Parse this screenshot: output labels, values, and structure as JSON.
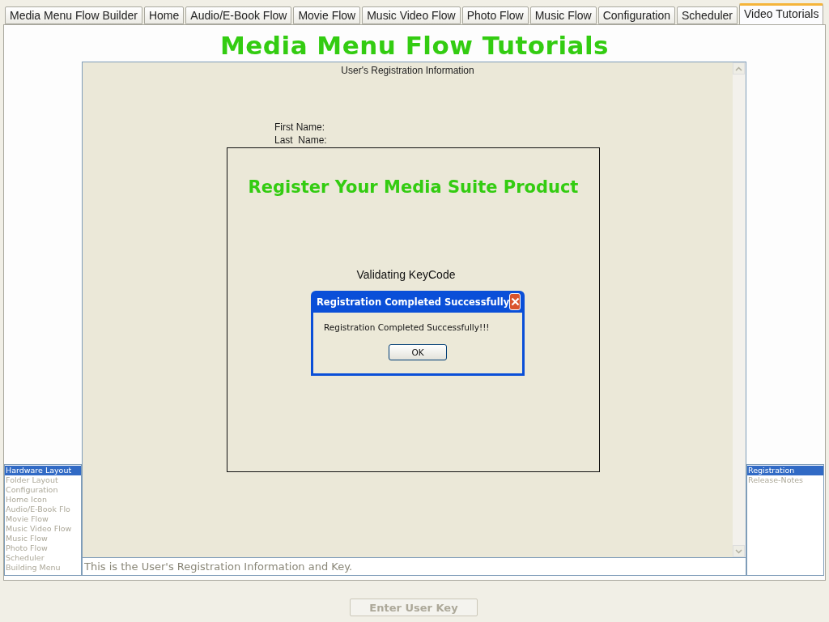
{
  "tabs": [
    {
      "label": "Media Menu Flow Builder",
      "selected": false
    },
    {
      "label": "Home",
      "selected": false
    },
    {
      "label": "Audio/E-Book Flow",
      "selected": false
    },
    {
      "label": "Movie Flow",
      "selected": false
    },
    {
      "label": "Music Video Flow",
      "selected": false
    },
    {
      "label": "Photo Flow",
      "selected": false
    },
    {
      "label": "Music Flow",
      "selected": false
    },
    {
      "label": "Configuration",
      "selected": false
    },
    {
      "label": "Scheduler",
      "selected": false
    },
    {
      "label": "Video Tutorials",
      "selected": true
    }
  ],
  "page_title": "Media Menu Flow Tutorials",
  "left_list": [
    {
      "label": "Hardware Layout",
      "selected": true
    },
    {
      "label": "Folder Layout",
      "selected": false
    },
    {
      "label": "Configuration",
      "selected": false
    },
    {
      "label": "Home Icon",
      "selected": false
    },
    {
      "label": "Audio/E-Book Flo",
      "selected": false
    },
    {
      "label": "Movie Flow",
      "selected": false
    },
    {
      "label": "Music Video Flow",
      "selected": false
    },
    {
      "label": "Music Flow",
      "selected": false
    },
    {
      "label": "Photo Flow",
      "selected": false
    },
    {
      "label": "Scheduler",
      "selected": false
    },
    {
      "label": "Building Menu",
      "selected": false
    }
  ],
  "right_list": [
    {
      "label": "Registration",
      "selected": true
    },
    {
      "label": "Release-Notes",
      "selected": false
    }
  ],
  "info_panel": {
    "heading": "User's Registration Information",
    "fields": [
      "First Name:",
      "Last  Name:"
    ]
  },
  "register_panel": {
    "title": "Register Your Media Suite Product",
    "status": "Validating KeyCode"
  },
  "dialog": {
    "title": "Registration Completed Successfully",
    "message": "Registration Completed Successfully!!!",
    "button": "OK"
  },
  "description": "This is the User's Registration Information and Key.",
  "action_button": {
    "label": "Enter User Key",
    "disabled": true
  }
}
